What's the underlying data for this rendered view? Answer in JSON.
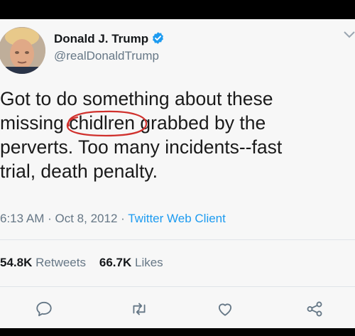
{
  "author": {
    "name": "Donald J. Trump",
    "handle": "@realDonaldTrump"
  },
  "tweet": {
    "lines": [
      "Got to do something about these",
      "grabbed by the",
      "perverts. Too many incidents--fast",
      "trial, death penalty."
    ],
    "line2_prefix": "missing ",
    "circled_word": "chidlren"
  },
  "meta": {
    "time": "6:13 AM",
    "sep": "·",
    "date": "Oct 8, 2012",
    "client": "Twitter Web Client"
  },
  "stats": {
    "retweets_count": "54.8K",
    "retweets_label": "Retweets",
    "likes_count": "66.7K",
    "likes_label": "Likes"
  },
  "actions": [
    "reply-icon",
    "retweet-icon",
    "like-icon",
    "share-icon"
  ],
  "colors": {
    "verified": "#1d9bf0",
    "link": "#1d9bf0",
    "annotation": "#d0312d",
    "muted": "#667786"
  }
}
